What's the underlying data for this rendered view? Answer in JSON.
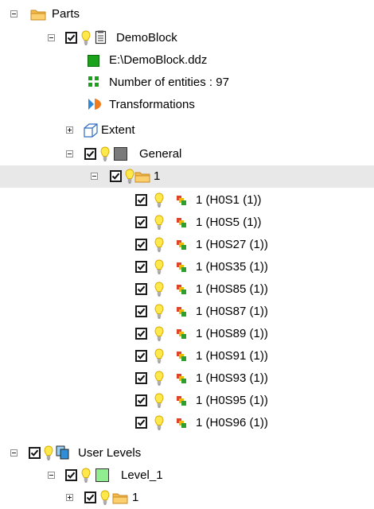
{
  "tree": {
    "parts": "Parts",
    "demoblock": "DemoBlock",
    "file_path": "E:\\DemoBlock.ddz",
    "entity_count": "Number of entities : 97",
    "transformations": "Transformations",
    "extent": "Extent",
    "general": "General",
    "group_1": "1",
    "entities": [
      "1 (H0S1 (1))",
      "1 (H0S5 (1))",
      "1 (H0S27 (1))",
      "1 (H0S35 (1))",
      "1 (H0S85 (1))",
      "1 (H0S87 (1))",
      "1 (H0S89 (1))",
      "1 (H0S91 (1))",
      "1 (H0S93 (1))",
      "1 (H0S95 (1))",
      "1 (H0S96 (1))"
    ],
    "user_levels": "User Levels",
    "level_1": "Level_1",
    "level_group_1": "1"
  },
  "colors": {
    "selection_bg": "#e8e8e8",
    "folder": "#f5a623",
    "bulb": "#ffe94a",
    "general_swatch": "#7a7a7a",
    "level_swatch": "#90ee90",
    "file_green": "#1aa31a"
  }
}
